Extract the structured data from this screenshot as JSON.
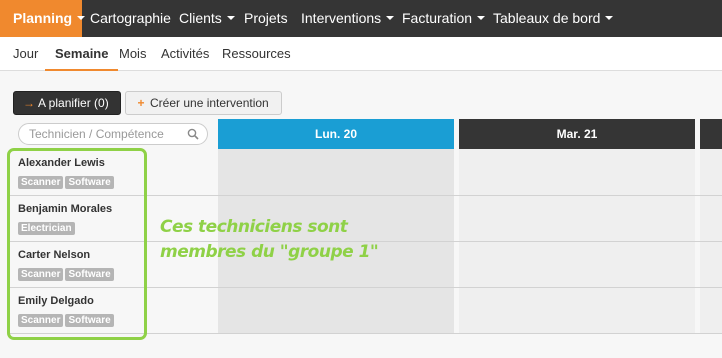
{
  "topnav": {
    "items": [
      {
        "label": "Planning",
        "caret": true
      },
      {
        "label": "Cartographie",
        "caret": false
      },
      {
        "label": "Clients",
        "caret": true
      },
      {
        "label": "Projets",
        "caret": false
      },
      {
        "label": "Interventions",
        "caret": true
      },
      {
        "label": "Facturation",
        "caret": true
      },
      {
        "label": "Tableaux de bord",
        "caret": true
      }
    ]
  },
  "subnav": {
    "tabs": [
      {
        "label": "Jour"
      },
      {
        "label": "Semaine"
      },
      {
        "label": "Mois"
      },
      {
        "label": "Activités"
      },
      {
        "label": "Ressources"
      }
    ]
  },
  "toolbar": {
    "plan_label": "A planifier (0)",
    "create_label": "Créer une intervention"
  },
  "search": {
    "placeholder": "Technicien / Compétence"
  },
  "days": [
    {
      "label": "Lun. 20"
    },
    {
      "label": "Mar. 21"
    }
  ],
  "technicians": [
    {
      "name": "Alexander Lewis",
      "tags": [
        "Scanner",
        "Software"
      ]
    },
    {
      "name": "Benjamin Morales",
      "tags": [
        "Electrician"
      ]
    },
    {
      "name": "Carter Nelson",
      "tags": [
        "Scanner",
        "Software"
      ]
    },
    {
      "name": "Emily Delgado",
      "tags": [
        "Scanner",
        "Software"
      ]
    }
  ],
  "annotation": {
    "line1": "Ces techniciens sont",
    "line2": "membres du \"groupe 1\""
  },
  "colors": {
    "accent": "#f0892e",
    "today": "#1a9ed4",
    "dark": "#353535",
    "highlight": "#8fd147"
  }
}
